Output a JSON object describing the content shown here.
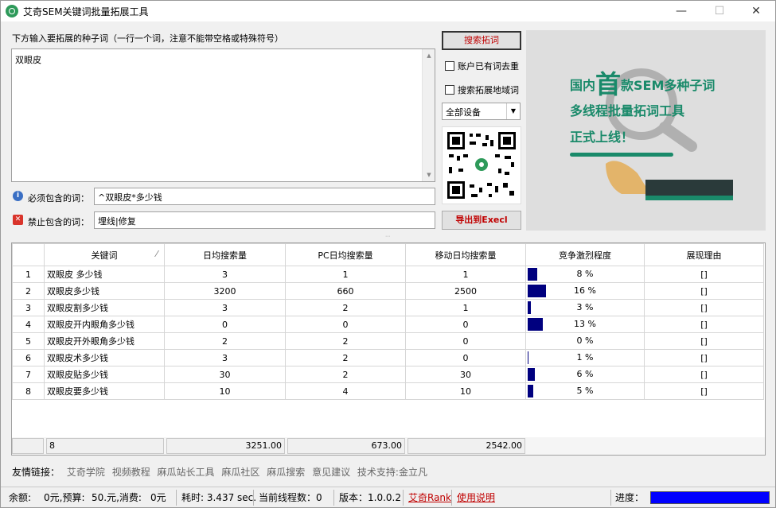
{
  "window": {
    "title": "艾奇SEM关键词批量拓展工具",
    "min": "—",
    "max": "☐",
    "close": "✕"
  },
  "seed": {
    "label": "下方输入要拓展的种子词（一行一个词，注意不能带空格或特殊符号）",
    "value": "双眼皮"
  },
  "filters": {
    "include_label": "必须包含的词：",
    "include_value": "^双眼皮*多少钱",
    "exclude_label": "禁止包含的词：",
    "exclude_value": "埋线|修复"
  },
  "controls": {
    "search_button": "搜索拓词",
    "dedupe_label": "账户已有词去重",
    "region_label": "搜索拓展地域词",
    "device_value": "全部设备",
    "export_button": "导出到Execl"
  },
  "banner": {
    "line1_pre": "国内",
    "line1_big": "首",
    "line1_post": "款SEM多种子词",
    "line2": "多线程批量拓词工具",
    "line3": "正式上线！"
  },
  "table": {
    "headers": [
      "关键词",
      "日均搜索量",
      "PC日均搜索量",
      "移动日均搜索量",
      "竞争激烈程度",
      "展现理由"
    ],
    "sort_glyph": "⁄",
    "rows": [
      {
        "n": "1",
        "kw": "双眼皮 多少钱",
        "daily": "3",
        "pc": "1",
        "mobile": "1",
        "comp": 8,
        "comp_text": "8 %",
        "reason": "[]"
      },
      {
        "n": "2",
        "kw": "双眼皮多少钱",
        "daily": "3200",
        "pc": "660",
        "mobile": "2500",
        "comp": 16,
        "comp_text": "16 %",
        "reason": "[]"
      },
      {
        "n": "3",
        "kw": "双眼皮割多少钱",
        "daily": "3",
        "pc": "2",
        "mobile": "1",
        "comp": 3,
        "comp_text": "3 %",
        "reason": "[]"
      },
      {
        "n": "4",
        "kw": "双眼皮开内眼角多少钱",
        "daily": "0",
        "pc": "0",
        "mobile": "0",
        "comp": 13,
        "comp_text": "13 %",
        "reason": "[]"
      },
      {
        "n": "5",
        "kw": "双眼皮开外眼角多少钱",
        "daily": "2",
        "pc": "2",
        "mobile": "0",
        "comp": 0,
        "comp_text": "0 %",
        "reason": "[]"
      },
      {
        "n": "6",
        "kw": "双眼皮术多少钱",
        "daily": "3",
        "pc": "2",
        "mobile": "0",
        "comp": 1,
        "comp_text": "1 %",
        "reason": "[]"
      },
      {
        "n": "7",
        "kw": "双眼皮贴多少钱",
        "daily": "30",
        "pc": "2",
        "mobile": "30",
        "comp": 6,
        "comp_text": "6 %",
        "reason": "[]"
      },
      {
        "n": "8",
        "kw": "双眼皮要多少钱",
        "daily": "10",
        "pc": "4",
        "mobile": "10",
        "comp": 5,
        "comp_text": "5 %",
        "reason": "[]"
      }
    ],
    "summary": {
      "count": "8",
      "daily": "3251.00",
      "pc": "673.00",
      "mobile": "2542.00"
    }
  },
  "links": {
    "label": "友情链接：",
    "items": [
      "艾奇学院",
      "视频教程",
      "麻瓜站长工具",
      "麻瓜社区",
      "麻瓜搜索",
      "意见建议",
      "技术支持:金立凡"
    ]
  },
  "status": {
    "balance": "余额:",
    "balance_val": "0元,预算:",
    "budget_val": "50.元,消费:",
    "spend_val": "0元",
    "time": "耗时: 3.437 sec.",
    "threads": "当前线程数：0",
    "version": "版本：1.0.0.2",
    "rank_link": "艾奇Rank",
    "help_link": "使用说明",
    "progress_label": "进度：",
    "progress_value": 1.0
  },
  "colors": {
    "bar": "#00007f",
    "accent": "#1a8a6a",
    "link": "#c00000",
    "progress": "#0000ff"
  }
}
